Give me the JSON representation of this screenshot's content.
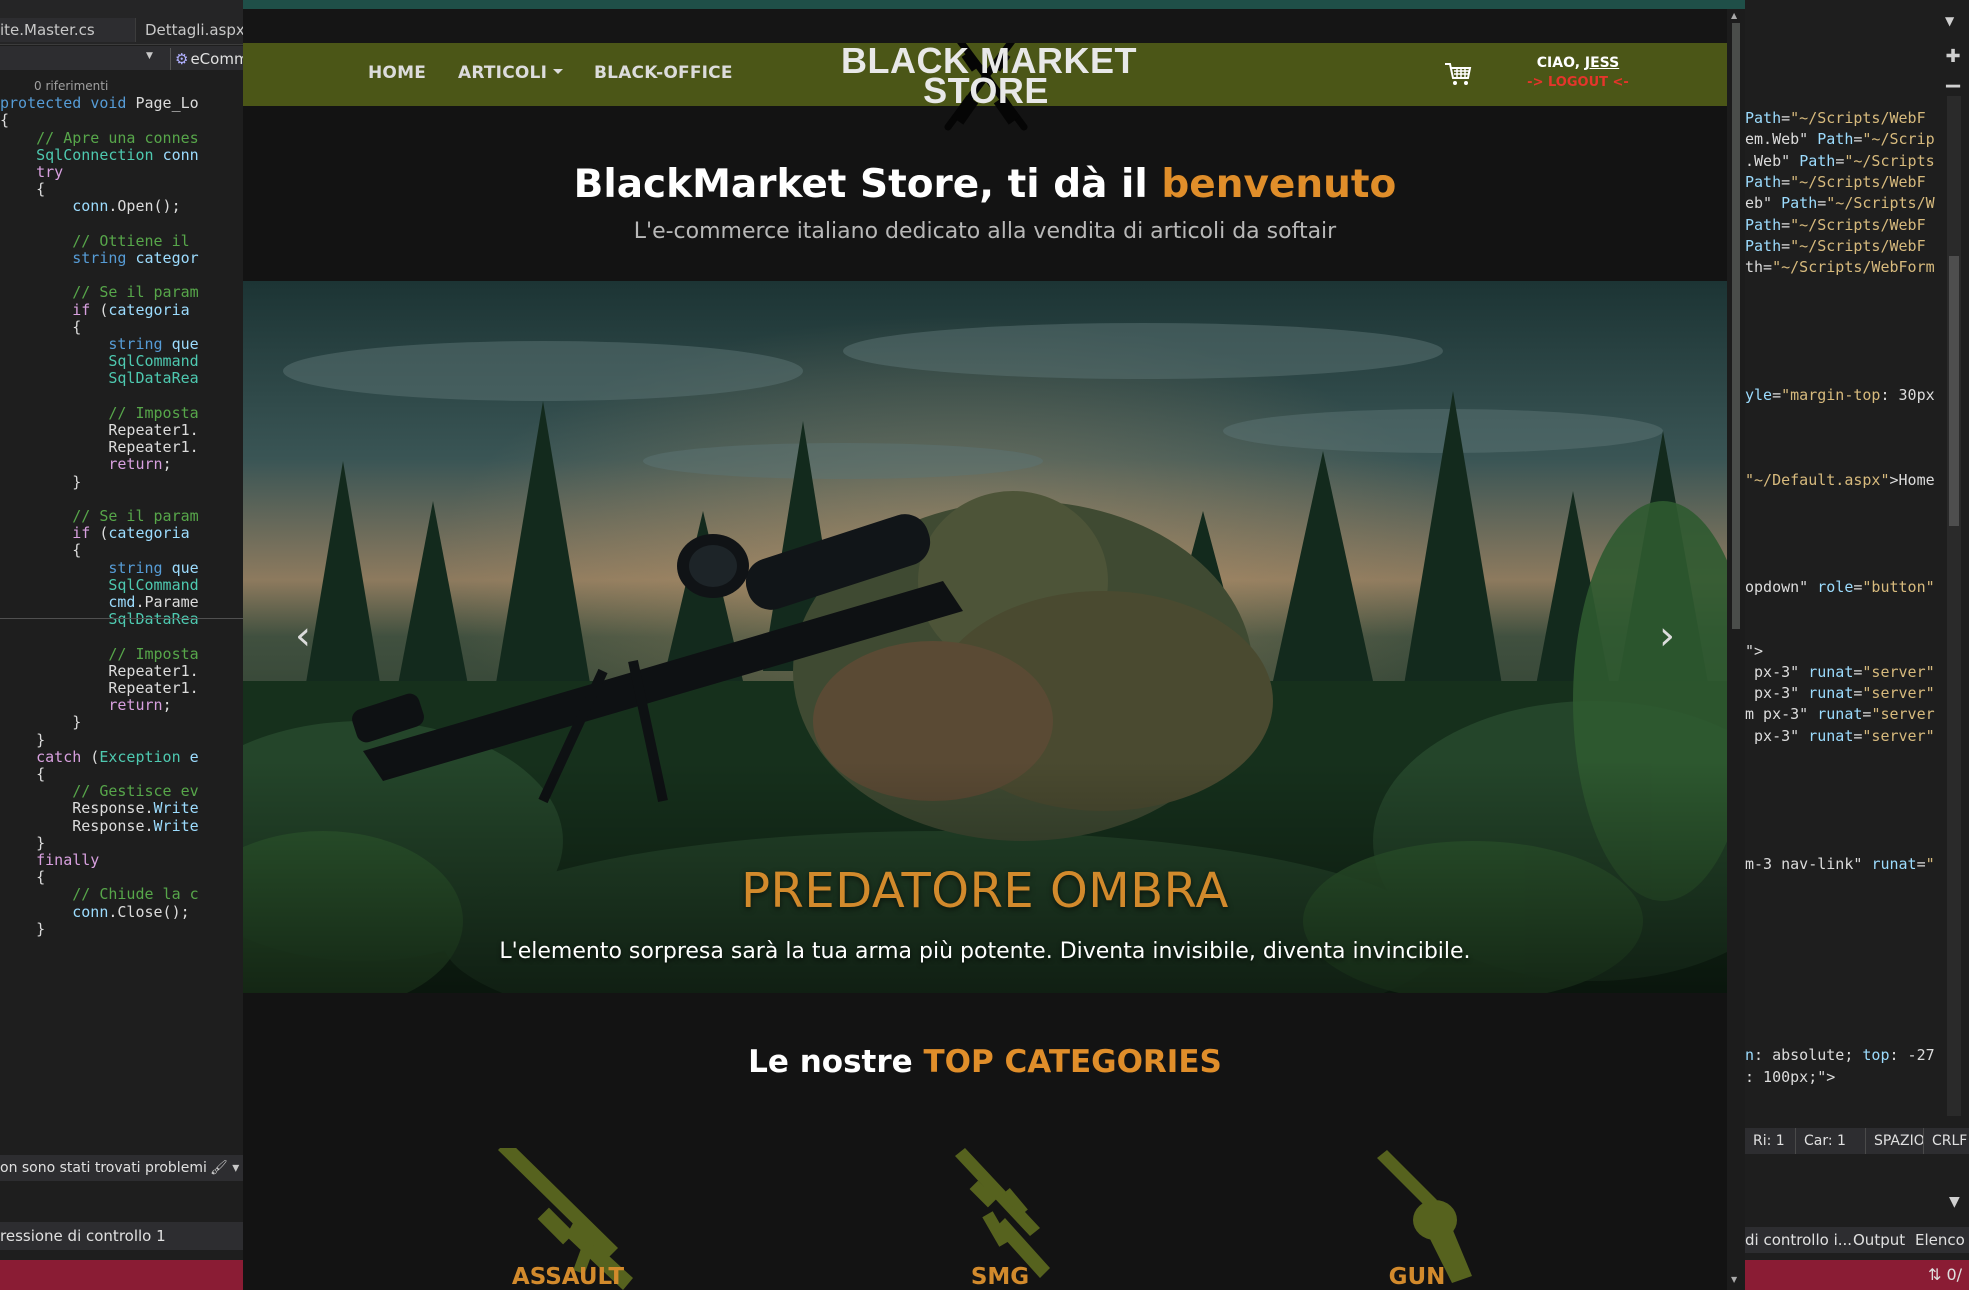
{
  "ide_left": {
    "tabs": [
      "ite.Master.cs",
      "Dettagli.aspx"
    ],
    "nav_context": "eComm",
    "code_lines": [
      {
        "text": "0 riferimenti",
        "kind": "refs"
      },
      {
        "parts": [
          [
            "kw",
            "protected"
          ],
          [
            "plain",
            " "
          ],
          [
            "kw",
            "void"
          ],
          [
            "plain",
            " Page_Lo"
          ]
        ]
      },
      {
        "parts": [
          [
            "plain",
            "{"
          ]
        ]
      },
      {
        "parts": [
          [
            "plain",
            "    "
          ],
          [
            "cm",
            "// Apre una connes"
          ]
        ]
      },
      {
        "parts": [
          [
            "plain",
            "    "
          ],
          [
            "ty",
            "SqlConnection"
          ],
          [
            "plain",
            " "
          ],
          [
            "id",
            "conn"
          ]
        ]
      },
      {
        "parts": [
          [
            "plain",
            "    "
          ],
          [
            "kw2",
            "try"
          ]
        ]
      },
      {
        "parts": [
          [
            "plain",
            "    {"
          ]
        ]
      },
      {
        "parts": [
          [
            "plain",
            "        "
          ],
          [
            "id",
            "conn"
          ],
          [
            "plain",
            ".Open();"
          ]
        ]
      },
      {
        "parts": [
          [
            "plain",
            ""
          ]
        ]
      },
      {
        "parts": [
          [
            "plain",
            "        "
          ],
          [
            "cm",
            "// Ottiene il"
          ]
        ]
      },
      {
        "parts": [
          [
            "plain",
            "        "
          ],
          [
            "kw",
            "string"
          ],
          [
            "plain",
            " "
          ],
          [
            "id",
            "categor"
          ]
        ]
      },
      {
        "parts": [
          [
            "plain",
            ""
          ]
        ]
      },
      {
        "parts": [
          [
            "plain",
            "        "
          ],
          [
            "cm",
            "// Se il param"
          ]
        ]
      },
      {
        "parts": [
          [
            "plain",
            "        "
          ],
          [
            "kw2",
            "if"
          ],
          [
            "plain",
            " ("
          ],
          [
            "id",
            "categoria"
          ]
        ]
      },
      {
        "parts": [
          [
            "plain",
            "        {"
          ]
        ]
      },
      {
        "parts": [
          [
            "plain",
            "            "
          ],
          [
            "kw",
            "string"
          ],
          [
            "plain",
            " "
          ],
          [
            "id",
            "que"
          ]
        ]
      },
      {
        "parts": [
          [
            "plain",
            "            "
          ],
          [
            "ty",
            "SqlCommand"
          ]
        ]
      },
      {
        "parts": [
          [
            "plain",
            "            "
          ],
          [
            "ty",
            "SqlDataRea"
          ]
        ]
      },
      {
        "parts": [
          [
            "plain",
            ""
          ]
        ]
      },
      {
        "parts": [
          [
            "plain",
            "            "
          ],
          [
            "cm",
            "// Imposta"
          ]
        ]
      },
      {
        "parts": [
          [
            "plain",
            "            Repeater1."
          ]
        ]
      },
      {
        "parts": [
          [
            "plain",
            "            Repeater1."
          ]
        ]
      },
      {
        "parts": [
          [
            "plain",
            "            "
          ],
          [
            "kw2",
            "return"
          ],
          [
            "plain",
            ";"
          ]
        ]
      },
      {
        "parts": [
          [
            "plain",
            "        }"
          ]
        ]
      },
      {
        "parts": [
          [
            "plain",
            ""
          ]
        ]
      },
      {
        "parts": [
          [
            "plain",
            "        "
          ],
          [
            "cm",
            "// Se il param"
          ]
        ]
      },
      {
        "parts": [
          [
            "plain",
            "        "
          ],
          [
            "kw2",
            "if"
          ],
          [
            "plain",
            " ("
          ],
          [
            "id",
            "categoria"
          ]
        ]
      },
      {
        "parts": [
          [
            "plain",
            "        {"
          ]
        ]
      },
      {
        "parts": [
          [
            "plain",
            "            "
          ],
          [
            "kw",
            "string"
          ],
          [
            "plain",
            " "
          ],
          [
            "id",
            "que"
          ]
        ]
      },
      {
        "parts": [
          [
            "plain",
            "            "
          ],
          [
            "ty",
            "SqlCommand"
          ]
        ]
      },
      {
        "parts": [
          [
            "plain",
            "            "
          ],
          [
            "id",
            "cmd"
          ],
          [
            "plain",
            ".Parame"
          ]
        ]
      },
      {
        "parts": [
          [
            "plain",
            "            "
          ],
          [
            "ty",
            "SqlDataRea"
          ]
        ]
      },
      {
        "parts": [
          [
            "plain",
            ""
          ]
        ]
      },
      {
        "parts": [
          [
            "plain",
            "            "
          ],
          [
            "cm",
            "// Imposta"
          ]
        ]
      },
      {
        "parts": [
          [
            "plain",
            "            Repeater1."
          ]
        ]
      },
      {
        "parts": [
          [
            "plain",
            "            Repeater1."
          ]
        ]
      },
      {
        "parts": [
          [
            "plain",
            "            "
          ],
          [
            "kw2",
            "return"
          ],
          [
            "plain",
            ";"
          ]
        ]
      },
      {
        "parts": [
          [
            "plain",
            "        }"
          ]
        ]
      },
      {
        "parts": [
          [
            "plain",
            "    }"
          ]
        ]
      },
      {
        "parts": [
          [
            "plain",
            "    "
          ],
          [
            "kw2",
            "catch"
          ],
          [
            "plain",
            " ("
          ],
          [
            "ty",
            "Exception"
          ],
          [
            "plain",
            " "
          ],
          [
            "id",
            "e"
          ]
        ]
      },
      {
        "parts": [
          [
            "plain",
            "    {"
          ]
        ]
      },
      {
        "parts": [
          [
            "plain",
            "        "
          ],
          [
            "cm",
            "// Gestisce ev"
          ]
        ]
      },
      {
        "parts": [
          [
            "plain",
            "        Response."
          ],
          [
            "id",
            "Write"
          ]
        ]
      },
      {
        "parts": [
          [
            "plain",
            "        Response."
          ],
          [
            "id",
            "Write"
          ]
        ]
      },
      {
        "parts": [
          [
            "plain",
            "    }"
          ]
        ]
      },
      {
        "parts": [
          [
            "plain",
            "    "
          ],
          [
            "kw2",
            "finally"
          ]
        ]
      },
      {
        "parts": [
          [
            "plain",
            "    {"
          ]
        ]
      },
      {
        "parts": [
          [
            "plain",
            "        "
          ],
          [
            "cm",
            "// Chiude la c"
          ]
        ]
      },
      {
        "parts": [
          [
            "plain",
            "        "
          ],
          [
            "id",
            "conn"
          ],
          [
            "plain",
            ".Close();"
          ]
        ]
      },
      {
        "parts": [
          [
            "plain",
            "    }"
          ]
        ]
      }
    ],
    "status_text": "on sono stati trovati problemi",
    "lower_panel_text": "ressione di controllo 1"
  },
  "ide_right": {
    "code_lines": [
      {
        "row": 0,
        "parts": [
          [
            "attr",
            "Path"
          ],
          [
            "plain",
            "="
          ],
          [
            "str",
            "\"~/Scripts/WebF"
          ]
        ]
      },
      {
        "row": 1,
        "parts": [
          [
            "plain",
            "em.Web\" "
          ],
          [
            "attr",
            "Path"
          ],
          [
            "plain",
            "="
          ],
          [
            "str",
            "\"~/Scrip"
          ]
        ]
      },
      {
        "row": 2,
        "parts": [
          [
            "plain",
            ".Web\" "
          ],
          [
            "attr",
            "Path"
          ],
          [
            "plain",
            "="
          ],
          [
            "str",
            "\"~/Scripts"
          ]
        ]
      },
      {
        "row": 3,
        "parts": [
          [
            "attr",
            "Path"
          ],
          [
            "plain",
            "="
          ],
          [
            "str",
            "\"~/Scripts/WebF"
          ]
        ]
      },
      {
        "row": 4,
        "parts": [
          [
            "plain",
            "eb\" "
          ],
          [
            "attr",
            "Path"
          ],
          [
            "plain",
            "="
          ],
          [
            "str",
            "\"~/Scripts/W"
          ]
        ]
      },
      {
        "row": 5,
        "parts": [
          [
            "attr",
            "Path"
          ],
          [
            "plain",
            "="
          ],
          [
            "str",
            "\"~/Scripts/WebF"
          ]
        ]
      },
      {
        "row": 6,
        "parts": [
          [
            "attr",
            "Path"
          ],
          [
            "plain",
            "="
          ],
          [
            "str",
            "\"~/Scripts/WebF"
          ]
        ]
      },
      {
        "row": 7,
        "parts": [
          [
            "plain",
            "th="
          ],
          [
            "str",
            "\"~/Scripts/WebForm"
          ]
        ]
      },
      {
        "row": 13,
        "parts": [
          [
            "attr",
            "yle"
          ],
          [
            "plain",
            "="
          ],
          [
            "str",
            "\"margin-top"
          ],
          [
            "plain",
            ": 30px"
          ]
        ]
      },
      {
        "row": 17,
        "parts": [
          [
            "str",
            "\"~/Default.aspx\""
          ],
          [
            "plain",
            ">Home"
          ]
        ]
      },
      {
        "row": 22,
        "parts": [
          [
            "plain",
            "opdown\" "
          ],
          [
            "attr",
            "role"
          ],
          [
            "plain",
            "="
          ],
          [
            "str",
            "\"button\""
          ]
        ]
      },
      {
        "row": 25,
        "parts": [
          [
            "plain",
            "\">"
          ]
        ]
      },
      {
        "row": 26,
        "parts": [
          [
            "plain",
            " px-3\" "
          ],
          [
            "attr",
            "runat"
          ],
          [
            "plain",
            "="
          ],
          [
            "str",
            "\"server\""
          ]
        ]
      },
      {
        "row": 27,
        "parts": [
          [
            "plain",
            " px-3\" "
          ],
          [
            "attr",
            "runat"
          ],
          [
            "plain",
            "="
          ],
          [
            "str",
            "\"server\""
          ]
        ]
      },
      {
        "row": 28,
        "parts": [
          [
            "plain",
            "m px-3\" "
          ],
          [
            "attr",
            "runat"
          ],
          [
            "plain",
            "="
          ],
          [
            "str",
            "\"server"
          ]
        ]
      },
      {
        "row": 29,
        "parts": [
          [
            "plain",
            " px-3\" "
          ],
          [
            "attr",
            "runat"
          ],
          [
            "plain",
            "="
          ],
          [
            "str",
            "\"server\""
          ]
        ]
      },
      {
        "row": 35,
        "parts": [
          [
            "plain",
            "m-3 nav-link\" "
          ],
          [
            "attr",
            "runat"
          ],
          [
            "plain",
            "="
          ],
          [
            "str",
            "\""
          ]
        ]
      },
      {
        "row": 44,
        "parts": [
          [
            "attr",
            "n"
          ],
          [
            "plain",
            ": absolute; "
          ],
          [
            "attr",
            "top"
          ],
          [
            "plain",
            ": -27"
          ]
        ]
      },
      {
        "row": 45,
        "parts": [
          [
            "plain",
            ": 100px;\">"
          ]
        ]
      }
    ],
    "status": {
      "line": "Ri: 1",
      "col": "Car: 1",
      "spacing": "SPAZIO",
      "eol": "CRLF"
    },
    "lower_panel_text": "di controllo i...",
    "lower_tabs": [
      "Output",
      "Elenco"
    ],
    "bottom_status": "⇅ 0/"
  },
  "site": {
    "nav": {
      "home": "HOME",
      "articoli": "ARTICOLI",
      "black_office": "BLACK-OFFICE"
    },
    "logo": {
      "line1": "BLACK MARKET",
      "line2": "STORE"
    },
    "user": {
      "greeting": "CIAO,",
      "name": "JESS",
      "logout": "-> LOGOUT <-"
    },
    "hero": {
      "title_main": "BlackMarket Store, ti dà il ",
      "title_accent": "benvenuto",
      "subtitle": "L'e-commerce italiano dedicato alla vendita di articoli da softair"
    },
    "carousel": {
      "slide_title": "PREDATORE OMBRA",
      "slide_caption": "L'elemento sorpresa sarà la tua arma più potente. Diventa invisibile, diventa invincibile.",
      "prev_icon": "‹",
      "next_icon": "›",
      "slide_count": 5,
      "active_index": 2
    },
    "categories": {
      "title_main": "Le nostre ",
      "title_accent": "TOP CATEGORIES",
      "items": [
        "ASSAULT",
        "SMG",
        "GUN"
      ]
    },
    "colors": {
      "navbar": "#4b5617",
      "accent": "#e08e2a",
      "logout": "#e5352b",
      "background": "#131313",
      "icon_olive": "#56621e"
    }
  }
}
